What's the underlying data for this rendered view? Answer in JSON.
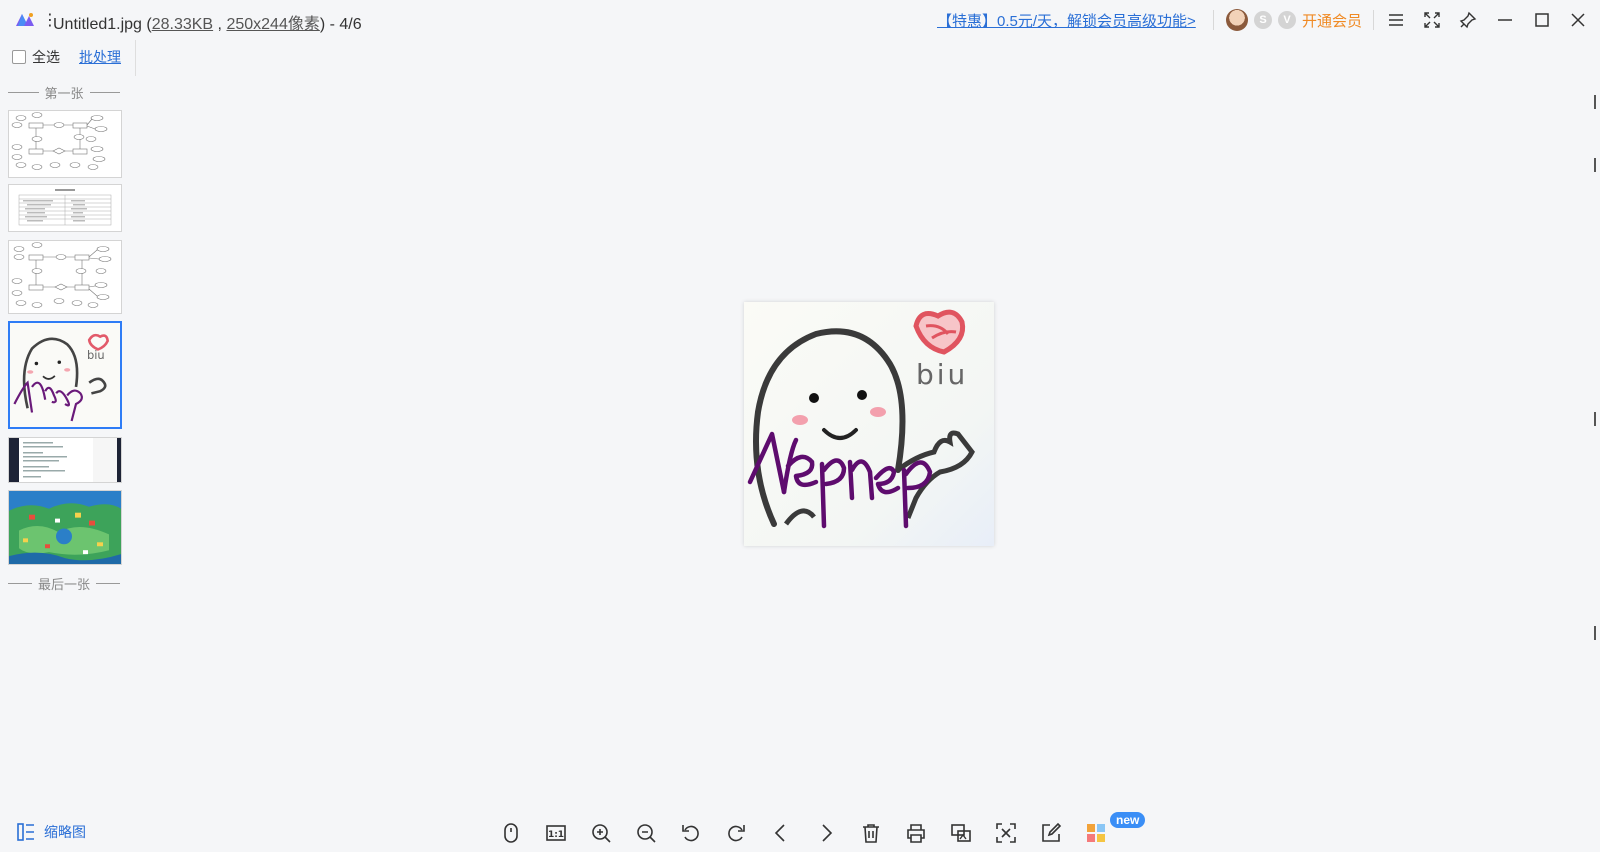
{
  "titlebar": {
    "file_name": "Untitled1.jpg (",
    "file_size": "28.33KB",
    "separator": " , ",
    "dimensions": "250x244像素",
    "position_suffix": ") - 4/6",
    "menu_glyph": "⋮",
    "promo": "【特惠】0.5元/天，解锁会员高级功能>",
    "vip_label": "开通会员",
    "badge_s": "S",
    "badge_v": "V"
  },
  "sidebar": {
    "select_all": "全选",
    "batch": "批处理",
    "first_label": "第一张",
    "last_label": "最后一张",
    "selected_index": 4
  },
  "toolbar": {
    "thumbnail_label": "缩略图",
    "ratio_label": "1:1",
    "new_badge": "new"
  },
  "image": {
    "text_biu": "biu",
    "text_signature": "Nepnep"
  },
  "colors": {
    "accent": "#2e7cf6",
    "link": "#2a6fd6",
    "vip": "#f08a24"
  }
}
